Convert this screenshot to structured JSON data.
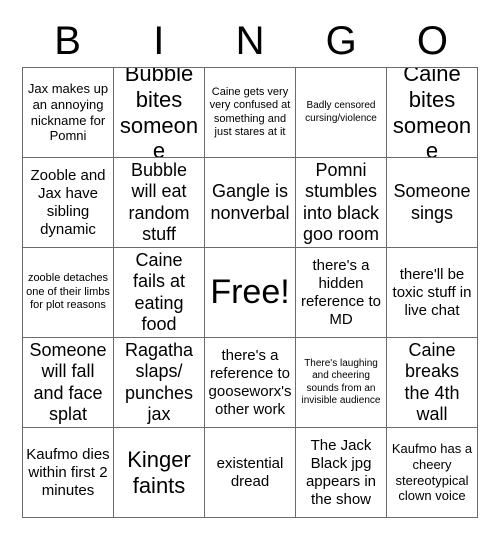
{
  "card": {
    "title": "BINGO",
    "header_letters": [
      "B",
      "I",
      "N",
      "G",
      "O"
    ],
    "grid_size": "5x5",
    "free_space_index": 12,
    "colors": {
      "background": "#ffffff",
      "text": "#000000",
      "border": "#6b6b6b"
    },
    "cells": [
      {
        "text": "Jax makes up an annoying nickname for Pomni",
        "size": "sm",
        "free": false
      },
      {
        "text": "Bubble bites someone",
        "size": "xl",
        "free": false
      },
      {
        "text": "Caine gets very very confused at something and just stares at it",
        "size": "xs",
        "free": false
      },
      {
        "text": "Badly censored cursing/violence",
        "size": "xxs",
        "free": false
      },
      {
        "text": "Caine bites someone",
        "size": "xl",
        "free": false
      },
      {
        "text": "Zooble and Jax have sibling dynamic",
        "size": "md",
        "free": false
      },
      {
        "text": "Bubble will eat random stuff",
        "size": "lg",
        "free": false
      },
      {
        "text": "Gangle is nonverbal",
        "size": "lg",
        "free": false
      },
      {
        "text": "Pomni stumbles into black goo room",
        "size": "lg",
        "free": false
      },
      {
        "text": "Someone sings",
        "size": "lg",
        "free": false
      },
      {
        "text": "zooble detaches one of their limbs for plot reasons",
        "size": "xs",
        "free": false
      },
      {
        "text": "Caine fails at eating food",
        "size": "lg",
        "free": false
      },
      {
        "text": "Free!",
        "size": "xxl",
        "free": true
      },
      {
        "text": "there's a hidden reference to MD",
        "size": "md",
        "free": false
      },
      {
        "text": "there'll be toxic stuff in live chat",
        "size": "md",
        "free": false
      },
      {
        "text": "Someone will fall and face splat",
        "size": "lg",
        "free": false
      },
      {
        "text": "Ragatha slaps/ punches jax",
        "size": "lg",
        "free": false
      },
      {
        "text": "there's a reference to gooseworx's other work",
        "size": "md",
        "free": false
      },
      {
        "text": "There's laughing and cheering sounds from an invisible audience",
        "size": "xxs",
        "free": false
      },
      {
        "text": "Caine breaks the 4th wall",
        "size": "lg",
        "free": false
      },
      {
        "text": "Kaufmo dies within first 2 minutes",
        "size": "md",
        "free": false
      },
      {
        "text": "Kinger faints",
        "size": "xl",
        "free": false
      },
      {
        "text": "existential dread",
        "size": "md",
        "free": false
      },
      {
        "text": "The Jack Black jpg appears in the show",
        "size": "md",
        "free": false
      },
      {
        "text": "Kaufmo has a cheery stereotypical clown voice",
        "size": "sm",
        "free": false
      }
    ]
  }
}
